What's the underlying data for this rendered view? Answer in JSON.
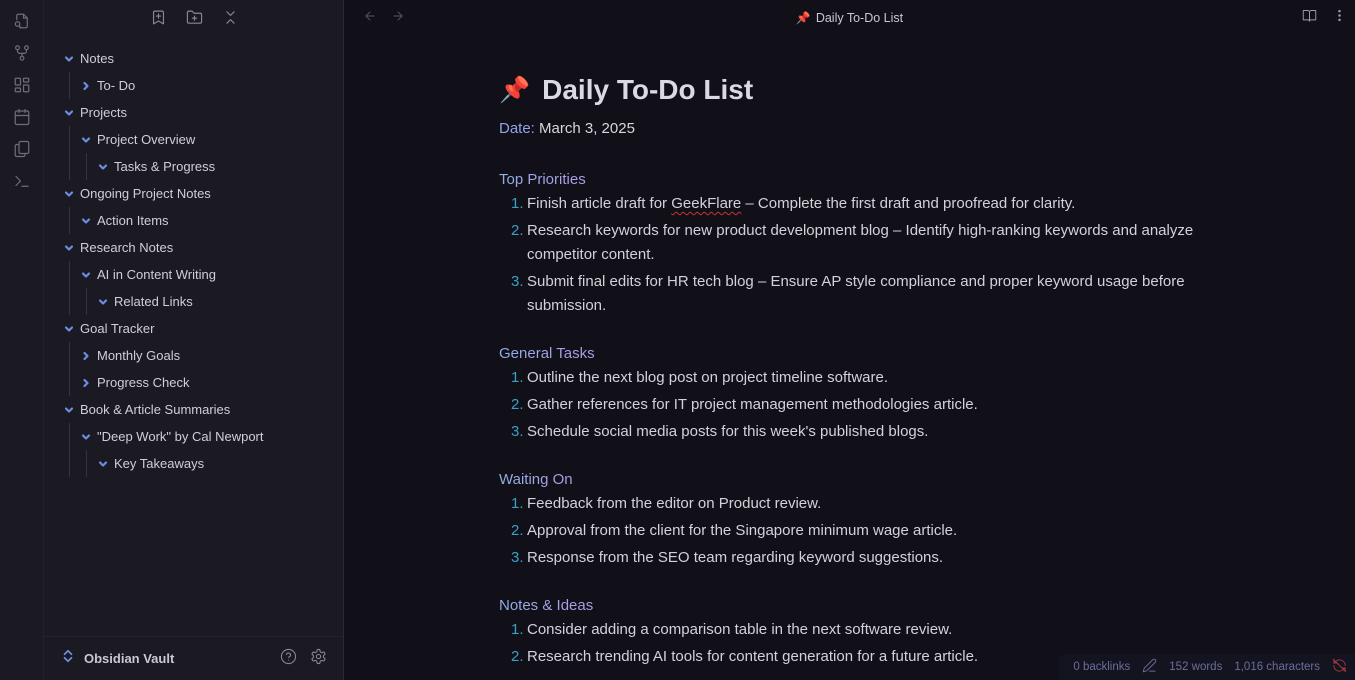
{
  "ribbon": {
    "icons": [
      {
        "name": "search-file-icon"
      },
      {
        "name": "graph-view-icon"
      },
      {
        "name": "canvas-icon"
      },
      {
        "name": "calendar-icon"
      },
      {
        "name": "copy-icon"
      },
      {
        "name": "command-palette-icon"
      }
    ]
  },
  "sidebar": {
    "toolbar": {
      "new_note_icon": "bookmark-plus-icon",
      "new_folder_icon": "folder-plus-icon",
      "collapse_icon": "collapse-all-icon"
    },
    "tree": [
      {
        "label": "Notes",
        "level": 0,
        "expanded": true
      },
      {
        "label": "To- Do",
        "level": 1,
        "expanded": false
      },
      {
        "label": "Projects",
        "level": 0,
        "expanded": true
      },
      {
        "label": "Project Overview",
        "level": 1,
        "expanded": true
      },
      {
        "label": "Tasks & Progress",
        "level": 2,
        "expanded": true
      },
      {
        "label": "Ongoing Project Notes",
        "level": 0,
        "expanded": true
      },
      {
        "label": "Action Items",
        "level": 1,
        "expanded": true
      },
      {
        "label": "Research Notes",
        "level": 0,
        "expanded": true
      },
      {
        "label": "AI in Content Writing",
        "level": 1,
        "expanded": true
      },
      {
        "label": "Related Links",
        "level": 2,
        "expanded": true
      },
      {
        "label": "Goal Tracker",
        "level": 0,
        "expanded": true
      },
      {
        "label": "Monthly Goals",
        "level": 1,
        "expanded": false
      },
      {
        "label": "Progress Check",
        "level": 1,
        "expanded": false
      },
      {
        "label": "Book & Article Summaries",
        "level": 0,
        "expanded": true
      },
      {
        "label": "\"Deep Work\" by Cal Newport",
        "level": 1,
        "expanded": true
      },
      {
        "label": "Key Takeaways",
        "level": 2,
        "expanded": true
      }
    ],
    "footer": {
      "vault_name": "Obsidian Vault",
      "help_icon": "help-icon",
      "settings_icon": "gear-icon"
    }
  },
  "topbar": {
    "back_icon": "arrow-left-icon",
    "forward_icon": "arrow-right-icon",
    "tab_emoji": "📌",
    "tab_title": "Daily To-Do List",
    "reading_view_icon": "book-open-icon",
    "more_icon": "more-vertical-icon"
  },
  "document": {
    "title_emoji": "📌",
    "title": "Daily To-Do List",
    "date_label": "Date:",
    "date_value": " March 3, 2025",
    "sections": [
      {
        "heading": "Top Priorities",
        "items": [
          {
            "num": "1.",
            "pre": "Finish article draft for ",
            "flagged": "GeekFlare",
            "post": " – Complete the first draft and proofread for clarity."
          },
          {
            "num": "2.",
            "pre": "Research keywords for new product development blog – Identify high-ranking keywords and analyze competitor content.",
            "flagged": "",
            "post": ""
          },
          {
            "num": "3.",
            "pre": "Submit final edits for HR tech blog – Ensure AP style compliance and proper keyword usage before submission.",
            "flagged": "",
            "post": ""
          }
        ]
      },
      {
        "heading": "General Tasks",
        "items": [
          {
            "num": "1.",
            "pre": "Outline the next blog post on project timeline software.",
            "flagged": "",
            "post": ""
          },
          {
            "num": "2.",
            "pre": "Gather references for IT project management methodologies article.",
            "flagged": "",
            "post": ""
          },
          {
            "num": "3.",
            "pre": "Schedule social media posts for this week's published blogs.",
            "flagged": "",
            "post": ""
          }
        ]
      },
      {
        "heading": "Waiting On",
        "items": [
          {
            "num": "1.",
            "pre": "Feedback from the editor on Product review.",
            "flagged": "",
            "post": ""
          },
          {
            "num": "2.",
            "pre": "Approval from the client for the Singapore minimum wage article.",
            "flagged": "",
            "post": ""
          },
          {
            "num": "3.",
            "pre": "Response from the SEO team regarding keyword suggestions.",
            "flagged": "",
            "post": ""
          }
        ]
      },
      {
        "heading": "Notes & Ideas",
        "items": [
          {
            "num": "1.",
            "pre": "Consider adding a comparison table in the next software review.",
            "flagged": "",
            "post": ""
          },
          {
            "num": "2.",
            "pre": "Research trending AI tools for content generation for a future article.",
            "flagged": "",
            "post": ""
          }
        ]
      }
    ]
  },
  "statusbar": {
    "backlinks": "0 backlinks",
    "words": "152 words",
    "characters": "1,016 characters",
    "edit_icon": "pencil-icon",
    "sync_icon": "sync-off-icon"
  },
  "colors": {
    "accent": "#6d8de0",
    "heading": "#96a5ec",
    "list_number": "#3aa0c8",
    "spellcheck": "#d03030",
    "sync_error": "#a83a40"
  }
}
